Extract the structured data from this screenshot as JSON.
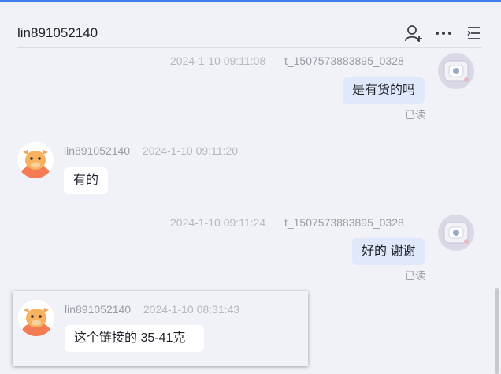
{
  "header": {
    "contact_name": "lin891052140",
    "icons": [
      "add-user-icon",
      "more-icon",
      "menu-icon"
    ]
  },
  "messages": [
    {
      "direction": "out",
      "time": "2024-1-10 09:11:08",
      "sender": "t_1507573883895_0328",
      "text": "是有货的吗",
      "status": "已读"
    },
    {
      "direction": "in",
      "sender": "lin891052140",
      "time": "2024-1-10 09:11:20",
      "text": "有的"
    },
    {
      "direction": "out",
      "time": "2024-1-10 09:11:24",
      "sender": "t_1507573883895_0328",
      "text": "好的 谢谢",
      "status": "已读"
    }
  ],
  "quoted_popup": {
    "sender": "lin891052140",
    "time": "2024-1-10 08:31:43",
    "text": "这个链接的  35-41克"
  },
  "colors": {
    "accent": "#3d7bf0",
    "outgoing_bubble": "#e0e8fb",
    "incoming_bubble": "#ffffff",
    "background": "#f1f2f7"
  }
}
